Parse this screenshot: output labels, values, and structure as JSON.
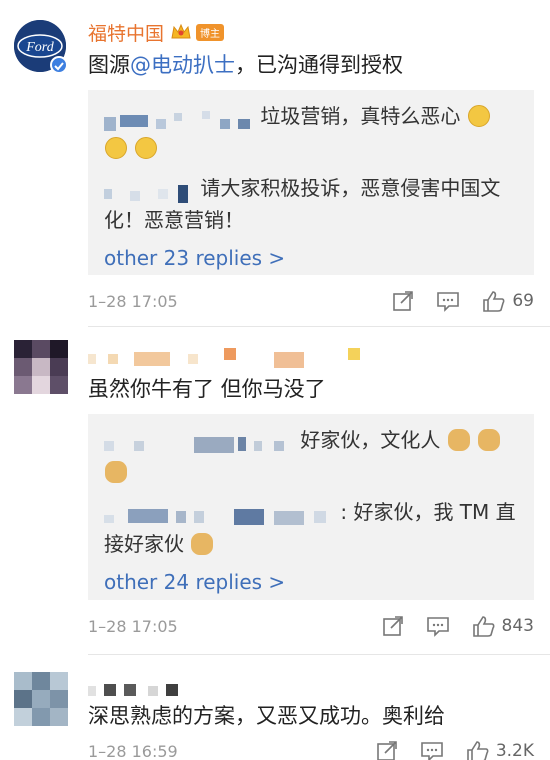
{
  "comments": [
    {
      "author": "福特中国",
      "author_badge": "博主",
      "text_prefix": "图源",
      "mention": "@电动扒士",
      "text_suffix": "，已沟通得到授权",
      "replies": [
        {
          "text": "垃圾营销，真特么恶心"
        },
        {
          "text": "请大家积极投诉，恶意侵害中国文化！恶意营销！"
        }
      ],
      "more_replies": "other 23 replies >",
      "time": "1–28 17:05",
      "likes": "69"
    },
    {
      "text": "虽然你牛有了 但你马没了",
      "replies": [
        {
          "text": "好家伙，文化人"
        },
        {
          "text": ": 好家伙，我 TM 直接好家伙"
        }
      ],
      "more_replies": "other 24 replies >",
      "time": "1–28 17:05",
      "likes": "843"
    },
    {
      "text": "深思熟虑的方案，又恶又成功。奥利给",
      "time": "1–28 16:59",
      "likes": "3.2K"
    }
  ],
  "colors": {
    "author": "#e8742f",
    "link": "#3f6fb9",
    "reply_bg": "#f2f2f2",
    "meta": "#9a9a9a"
  },
  "icons": {
    "repost": "repost-icon",
    "comment": "comment-icon",
    "like": "thumbs-up-icon"
  }
}
